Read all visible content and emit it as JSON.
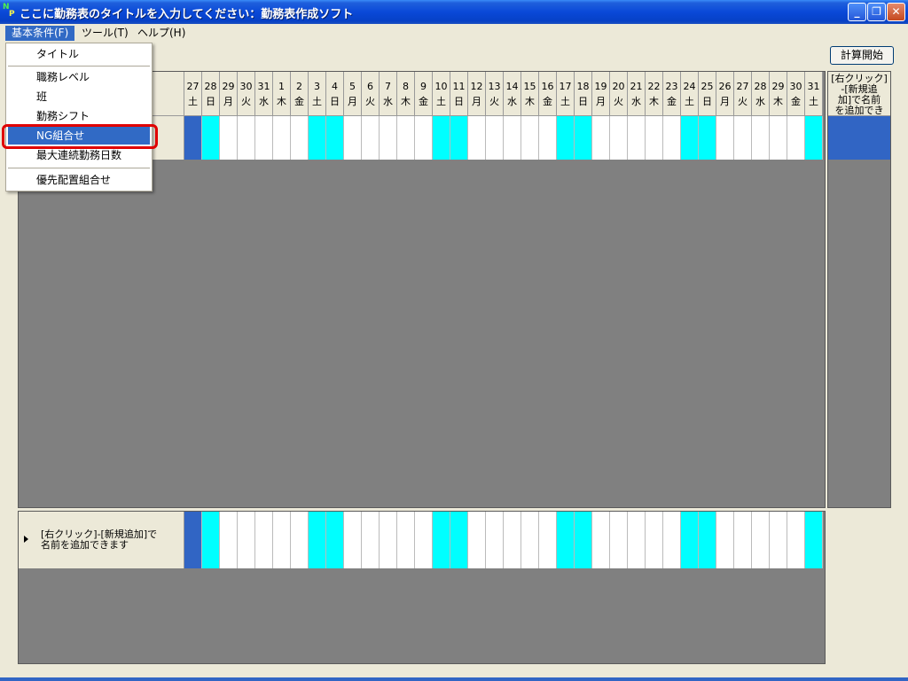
{
  "window": {
    "title": "ここに勤務表のタイトルを入力してください：勤務表作成ソフト",
    "minimize": "_",
    "restore": "❐",
    "close": "✕"
  },
  "menubar": [
    {
      "label": "基本条件(F)"
    },
    {
      "label": "ツール(T)"
    },
    {
      "label": "ヘルプ(H)"
    }
  ],
  "dropdown": {
    "items": [
      "タイトル",
      "職務レベル",
      "班",
      "勤務シフト",
      "NG組合せ",
      "最大連続勤務日数",
      "優先配置組合せ"
    ],
    "selected": "NG組合せ"
  },
  "toolbar": {
    "calc_button": "計算開始"
  },
  "calendar": {
    "days": [
      {
        "n": "27",
        "w": "土",
        "c": "blue"
      },
      {
        "n": "28",
        "w": "日",
        "c": "cyan"
      },
      {
        "n": "29",
        "w": "月",
        "c": "white"
      },
      {
        "n": "30",
        "w": "火",
        "c": "white"
      },
      {
        "n": "31",
        "w": "水",
        "c": "white"
      },
      {
        "n": "1",
        "w": "木",
        "c": "white"
      },
      {
        "n": "2",
        "w": "金",
        "c": "white"
      },
      {
        "n": "3",
        "w": "土",
        "c": "cyan"
      },
      {
        "n": "4",
        "w": "日",
        "c": "cyan"
      },
      {
        "n": "5",
        "w": "月",
        "c": "white"
      },
      {
        "n": "6",
        "w": "火",
        "c": "white"
      },
      {
        "n": "7",
        "w": "水",
        "c": "white"
      },
      {
        "n": "8",
        "w": "木",
        "c": "white"
      },
      {
        "n": "9",
        "w": "金",
        "c": "white"
      },
      {
        "n": "10",
        "w": "土",
        "c": "cyan"
      },
      {
        "n": "11",
        "w": "日",
        "c": "cyan"
      },
      {
        "n": "12",
        "w": "月",
        "c": "white"
      },
      {
        "n": "13",
        "w": "火",
        "c": "white"
      },
      {
        "n": "14",
        "w": "水",
        "c": "white"
      },
      {
        "n": "15",
        "w": "木",
        "c": "white"
      },
      {
        "n": "16",
        "w": "金",
        "c": "white"
      },
      {
        "n": "17",
        "w": "土",
        "c": "cyan"
      },
      {
        "n": "18",
        "w": "日",
        "c": "cyan"
      },
      {
        "n": "19",
        "w": "月",
        "c": "white"
      },
      {
        "n": "20",
        "w": "火",
        "c": "white"
      },
      {
        "n": "21",
        "w": "水",
        "c": "white"
      },
      {
        "n": "22",
        "w": "木",
        "c": "white"
      },
      {
        "n": "23",
        "w": "金",
        "c": "white"
      },
      {
        "n": "24",
        "w": "土",
        "c": "cyan"
      },
      {
        "n": "25",
        "w": "日",
        "c": "cyan"
      },
      {
        "n": "26",
        "w": "月",
        "c": "white"
      },
      {
        "n": "27",
        "w": "火",
        "c": "white"
      },
      {
        "n": "28",
        "w": "水",
        "c": "white"
      },
      {
        "n": "29",
        "w": "木",
        "c": "white"
      },
      {
        "n": "30",
        "w": "金",
        "c": "white"
      },
      {
        "n": "31",
        "w": "土",
        "c": "cyan"
      }
    ]
  },
  "bottom_row": {
    "label_line1": "[右クリック]-[新規追加]で",
    "label_line2": "名前を追加できます"
  },
  "right_panel": {
    "line1": "[右クリック]",
    "line2": "-[新規追",
    "line3": "加]で名前",
    "line4": "を追加でき"
  },
  "colors": {
    "blue": "#3165c4",
    "cyan": "#00ffff",
    "white": "#ffffff",
    "highlight": "#e00000"
  }
}
